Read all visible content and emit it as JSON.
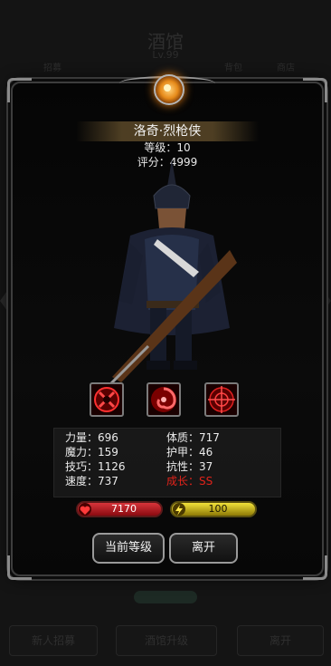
{
  "background": {
    "title": "酒馆",
    "subtitle": "Lv.99",
    "left_tab": "招募",
    "right_tab_1": "背包",
    "right_tab_2": "商店",
    "bottom_buttons": [
      "新人招募",
      "酒馆升级",
      "离开"
    ]
  },
  "dialog": {
    "hero": {
      "name": "洛奇·烈枪侠",
      "level_text": "等级：10",
      "score_text": "评分：4999"
    },
    "skills": [
      {
        "icon": "cross-target-icon"
      },
      {
        "icon": "swirl-icon"
      },
      {
        "icon": "crosshair-icon"
      }
    ],
    "stats": {
      "strength": "力量：696",
      "constitution": "体质：717",
      "magic": "魔力：159",
      "armor": "护甲：46",
      "skill": "技巧：1126",
      "resistance": "抗性：37",
      "speed": "速度：737",
      "growth": "成长：SS"
    },
    "hp_value": "7170",
    "energy_value": "100",
    "buttons": {
      "current_level": "当前等级",
      "leave": "离开"
    }
  },
  "colors": {
    "growth_text": "#e2231a",
    "hp_bar": "#c8232b",
    "energy_bar": "#d9c81f",
    "emblem": "#e68a1a"
  }
}
